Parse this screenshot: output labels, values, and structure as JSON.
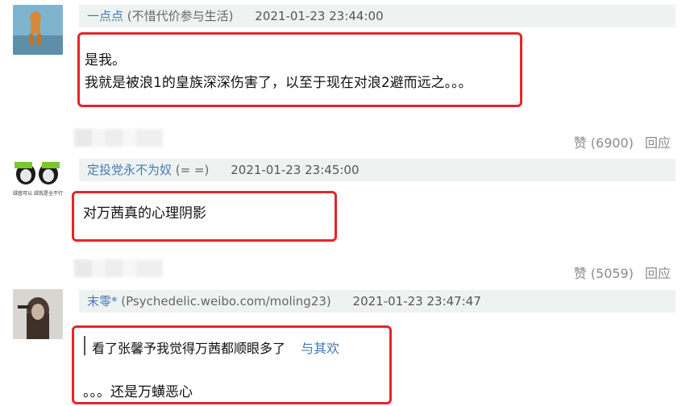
{
  "comments": [
    {
      "username": "一点点",
      "signature": "(不惜代价参与生活)",
      "time": "2021-01-23 23:44:00",
      "lines": [
        "是我。",
        "我就是被浪1的皇族深深伤害了，以至于现在对浪2避而远之。。。"
      ],
      "like_label": "赞 (6900)",
      "reply_label": "回应"
    },
    {
      "username": "定投党永不为奴",
      "signature": "(= =)",
      "time": "2021-01-23 23:45:00",
      "lines": [
        "对万茜真的心理阴影"
      ],
      "like_label": "赞 (5059)",
      "reply_label": "回应"
    },
    {
      "username": "末零*",
      "signature": "(Psychedelic.weibo.com/moling23)",
      "time": "2021-01-23 23:47:47",
      "quote_text": "看了张馨予我觉得万茜都顺眼多了",
      "quote_author": "与其欢",
      "lines": [
        "。。。还是万蟥恶心"
      ]
    }
  ],
  "avatar2_caption": "绿茵可以 绿我是全不行"
}
